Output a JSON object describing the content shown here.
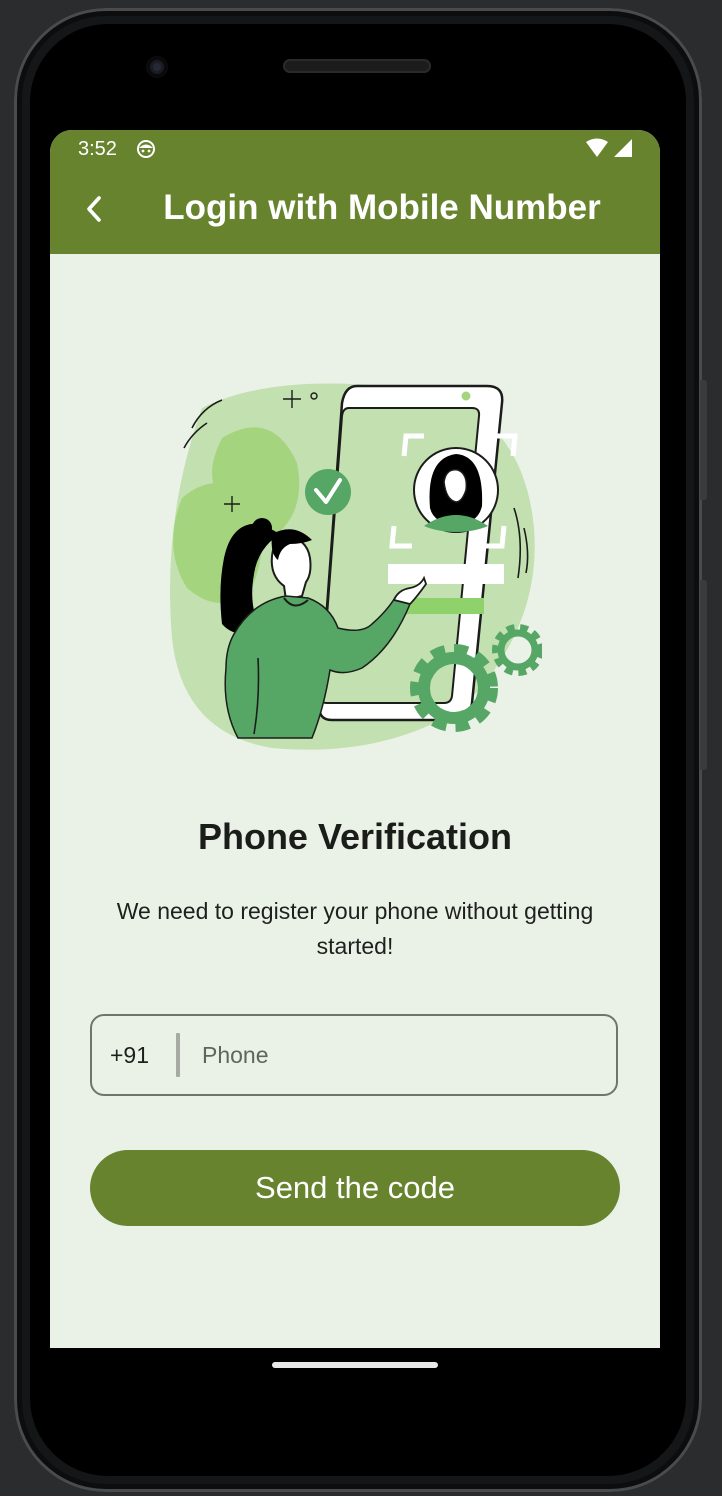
{
  "status_bar": {
    "time": "3:52",
    "icons": [
      "android-face-icon",
      "wifi-icon",
      "signal-icon"
    ]
  },
  "app_bar": {
    "title": "Login with Mobile Number",
    "back_icon": "chevron-left-icon"
  },
  "content": {
    "illustration": "phone-verification-illustration",
    "heading": "Phone Verification",
    "subtext": "We need to register your phone without getting started!",
    "country_code": "+91",
    "phone_placeholder": "Phone",
    "phone_value": "",
    "send_button_label": "Send the code"
  },
  "colors": {
    "primary": "#67832e",
    "background": "#eaf2e8",
    "illustration_green": "#56a665",
    "illustration_light": "#a4d57e"
  }
}
